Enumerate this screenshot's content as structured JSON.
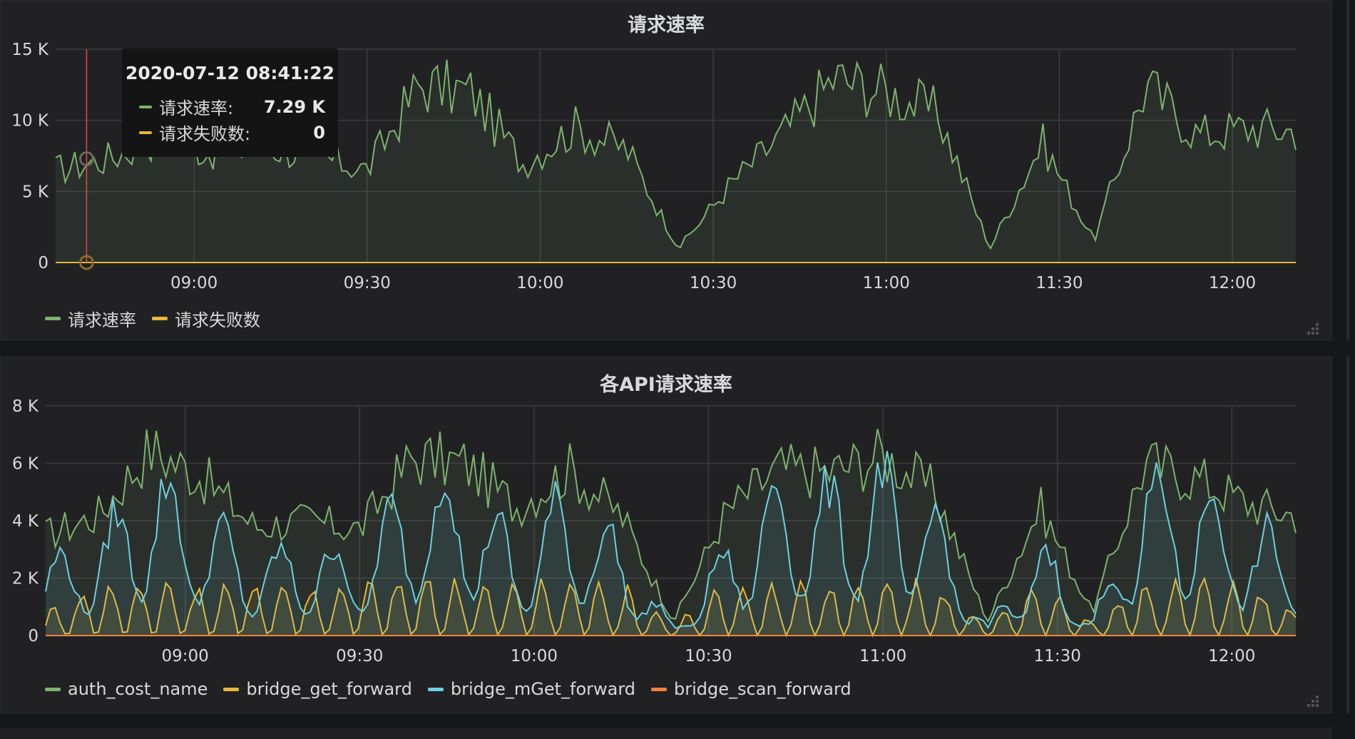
{
  "colors": {
    "green": "#7eb26d",
    "yellow": "#eab839",
    "blue": "#6ed0e0",
    "orange": "#ef843c",
    "grid": "#3c3d40",
    "marker": "#e24d42",
    "axis_text": "#d8d9da"
  },
  "icons": [
    "resize-handle-icon"
  ],
  "panel1": {
    "title": "请求速率",
    "legend": [
      {
        "label": "请求速率",
        "color": "#7eb26d"
      },
      {
        "label": "请求失败数",
        "color": "#eab839"
      }
    ],
    "tooltip": {
      "time": "2020-07-12 08:41:22",
      "rows": [
        {
          "label": "请求速率:",
          "value": "7.29 K",
          "color": "#7eb26d"
        },
        {
          "label": "请求失败数:",
          "value": "0",
          "color": "#eab839"
        }
      ]
    }
  },
  "panel2": {
    "title": "各API请求速率",
    "legend": [
      {
        "label": "auth_cost_name",
        "color": "#7eb26d"
      },
      {
        "label": "bridge_get_forward",
        "color": "#eab839"
      },
      {
        "label": "bridge_mGet_forward",
        "color": "#6ed0e0"
      },
      {
        "label": "bridge_scan_forward",
        "color": "#ef843c"
      }
    ]
  },
  "chart_data": [
    {
      "type": "area",
      "title": "请求速率",
      "x_ticks": [
        "09:00",
        "09:30",
        "10:00",
        "10:30",
        "11:00",
        "11:30",
        "12:00"
      ],
      "y_ticks": [
        "0",
        "5 K",
        "10 K",
        "15 K"
      ],
      "xlim": [
        "08:36",
        "12:11"
      ],
      "ylim": [
        0,
        15000
      ],
      "grid": true,
      "legend_position": "bottom-left",
      "x": [
        "08:36",
        "08:45",
        "08:54",
        "09:03",
        "09:12",
        "09:21",
        "09:30",
        "09:39",
        "09:48",
        "09:57",
        "10:06",
        "10:15",
        "10:24",
        "10:33",
        "10:42",
        "10:51",
        "11:00",
        "11:09",
        "11:18",
        "11:27",
        "11:36",
        "11:45",
        "11:54",
        "12:03",
        "12:11"
      ],
      "series": [
        {
          "name": "请求速率",
          "values": [
            6500,
            7300,
            8800,
            7800,
            8200,
            7500,
            6500,
            12500,
            12000,
            7000,
            9500,
            8000,
            1000,
            5500,
            9000,
            13000,
            12000,
            10500,
            1000,
            8500,
            1500,
            12500,
            9000,
            9500,
            9300
          ]
        },
        {
          "name": "请求失败数",
          "values": [
            0,
            0,
            0,
            0,
            0,
            0,
            0,
            0,
            0,
            0,
            0,
            0,
            0,
            0,
            0,
            0,
            0,
            0,
            0,
            0,
            0,
            0,
            0,
            0,
            0
          ]
        }
      ],
      "hover_time": "08:41:22",
      "hover_values": {
        "请求速率": 7290,
        "请求失败数": 0
      }
    },
    {
      "type": "area",
      "title": "各API请求速率",
      "x_ticks": [
        "09:00",
        "09:30",
        "10:00",
        "10:30",
        "11:00",
        "11:30",
        "12:00"
      ],
      "y_ticks": [
        "0",
        "2 K",
        "4 K",
        "6 K",
        "8 K"
      ],
      "xlim": [
        "08:36",
        "12:11"
      ],
      "ylim": [
        0,
        8000
      ],
      "grid": true,
      "legend_position": "bottom-left",
      "x": [
        "08:36",
        "08:45",
        "08:54",
        "09:03",
        "09:12",
        "09:21",
        "09:30",
        "09:39",
        "09:48",
        "09:57",
        "10:06",
        "10:15",
        "10:24",
        "10:33",
        "10:42",
        "10:51",
        "11:00",
        "11:09",
        "11:18",
        "11:27",
        "11:36",
        "11:45",
        "11:54",
        "12:03",
        "12:11"
      ],
      "series": [
        {
          "name": "auth_cost_name",
          "values": [
            3500,
            4200,
            6500,
            5500,
            3800,
            4000,
            3700,
            6200,
            6000,
            4500,
            5800,
            4200,
            500,
            4300,
            5800,
            5700,
            6300,
            5000,
            500,
            4500,
            800,
            6000,
            5500,
            4600,
            4200
          ]
        },
        {
          "name": "bridge_get_forward",
          "values": [
            800,
            1700,
            1900,
            1600,
            1900,
            1700,
            1800,
            1900,
            1800,
            1700,
            1800,
            1700,
            400,
            1700,
            1800,
            1700,
            1800,
            1700,
            400,
            1700,
            500,
            1800,
            1900,
            1700,
            900
          ]
        },
        {
          "name": "bridge_mGet_forward",
          "values": [
            2600,
            3500,
            6000,
            4500,
            2800,
            3300,
            3000,
            5500,
            5800,
            3200,
            5200,
            3300,
            300,
            3200,
            5600,
            5200,
            6000,
            4500,
            300,
            3500,
            500,
            5800,
            5500,
            3800,
            3400
          ]
        },
        {
          "name": "bridge_scan_forward",
          "values": [
            0,
            0,
            0,
            0,
            0,
            0,
            0,
            0,
            0,
            0,
            0,
            0,
            0,
            0,
            0,
            0,
            0,
            0,
            0,
            0,
            0,
            0,
            0,
            0,
            0
          ]
        }
      ]
    }
  ]
}
